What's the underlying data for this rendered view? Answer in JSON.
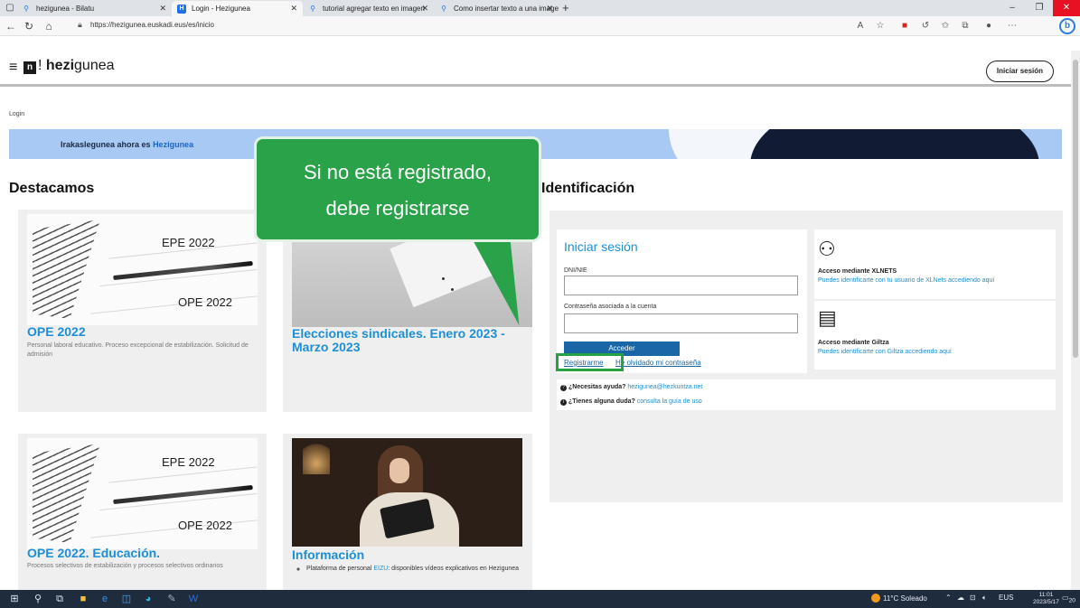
{
  "browser": {
    "tabs": [
      {
        "icon": "search-icon",
        "title": "hezigunea - Bilatu",
        "active": false
      },
      {
        "icon": "H",
        "title": "Login - Hezigunea",
        "active": true
      },
      {
        "icon": "search-icon",
        "title": "tutorial agregar texto en imagen",
        "active": false
      },
      {
        "icon": "search-icon",
        "title": "Como insertar texto a una image",
        "active": false
      }
    ],
    "new_tab": "+",
    "url": "https://hezigunea.euskadi.eus/es/inicio"
  },
  "site": {
    "logo_prefix": "n",
    "logo_bang": "!",
    "logo_bold": "hezi",
    "logo_rest": "gunea",
    "login_button": "Iniciar sesión",
    "breadcrumb": "Login"
  },
  "banner": {
    "text": "Irakaslegunea ahora es ",
    "accent": "Hezigunea"
  },
  "featured": {
    "title": "Destacamos",
    "cards": [
      {
        "title": "OPE 2022",
        "desc": "Personal laboral educativo. Proceso excepcional de estabilización. Solicitud de admisión",
        "img_top": "EPE 2022",
        "img_bottom": "OPE 2022"
      },
      {
        "title": "Elecciones sindicales. Enero 2023 - Marzo 2023",
        "desc": ""
      },
      {
        "title": "OPE 2022. Educación.",
        "desc": "Procesos selectivos de estabilización y procesos selectivos ordinarios",
        "img_top": "EPE 2022",
        "img_bottom": "OPE 2022"
      },
      {
        "title": "Información",
        "list_prefix": "Plataforma de personal ",
        "list_link": "EIZU",
        "list_suffix": ": disponibles vídeos explicativos en Hezigunea"
      }
    ]
  },
  "callout": {
    "line1": "Si no está registrado,",
    "line2": "debe registrarse"
  },
  "identification": {
    "title": "Identificación",
    "login": {
      "title": "Iniciar sesión",
      "dni_label": "DNI/NIE",
      "password_label": "Contraseña asociada a la cuenta",
      "submit": "Acceder",
      "register_link": "Registrarme",
      "forgot_link": "He olvidado mi contraseña"
    },
    "xlnets": {
      "title": "Acceso mediante XLNETS",
      "desc": "Puedes identificarte con tu usuario de XLNets accediendo aquí"
    },
    "giltza": {
      "title": "Acceso mediante Giltza",
      "desc": "Puedes identificarte con Giltza accediendo aquí"
    },
    "help": {
      "q1": "¿Necesitas ayuda?",
      "q1_link": "hezigunea@hezkuntza.net",
      "q2": "¿Tienes alguna duda?",
      "q2_link": "consulta la guía de uso"
    }
  },
  "taskbar": {
    "weather": "11°C Soleado",
    "lang": "EUS",
    "time": "11:01",
    "date": "2023/5/17",
    "notifications": "20"
  }
}
